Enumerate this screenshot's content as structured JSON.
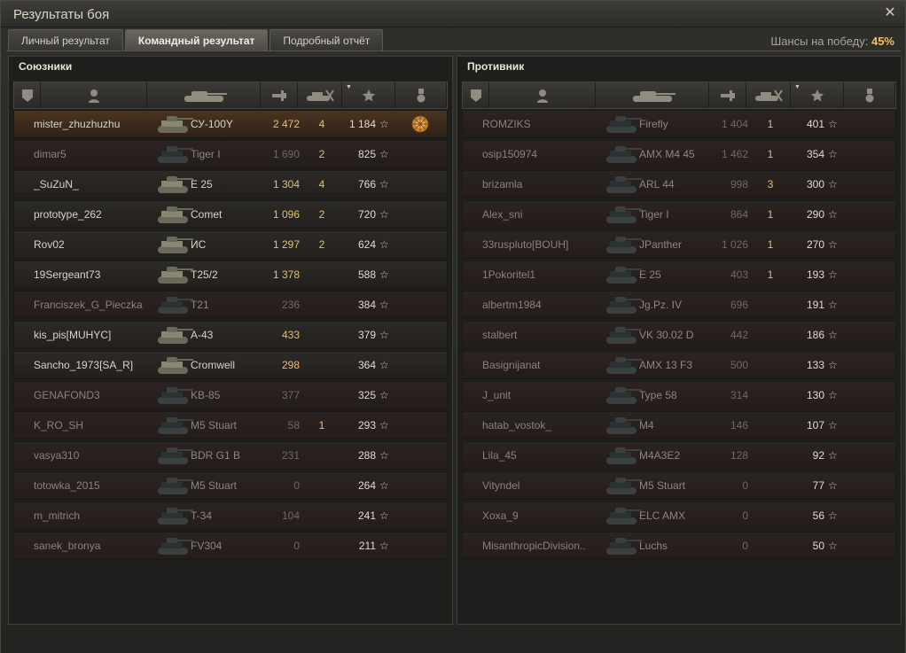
{
  "window": {
    "title": "Результаты боя",
    "close_glyph": "✕"
  },
  "tabs": [
    {
      "label": "Личный результат",
      "active": false
    },
    {
      "label": "Командный результат",
      "active": true
    },
    {
      "label": "Подробный отчёт",
      "active": false
    }
  ],
  "win_chance": {
    "label": "Шансы на победу:",
    "value": "45%"
  },
  "columns": [
    "squad-icon",
    "player-icon",
    "tank-icon",
    "damage-icon",
    "kills-icon",
    "xp-star-icon",
    "medal-icon"
  ],
  "allies": {
    "title": "Союзники",
    "rows": [
      {
        "name": "mister_zhuzhuzhu",
        "vehicle": "СУ-100Y",
        "damage": "2 472",
        "kills": "4",
        "xp": "1 184",
        "state": "me",
        "medal": true
      },
      {
        "name": "dimar5",
        "vehicle": "Tiger I",
        "damage": "1 690",
        "kills": "2",
        "xp": "825",
        "state": "dead"
      },
      {
        "name": "_SuZuN_",
        "vehicle": "E 25",
        "damage": "1 304",
        "kills": "4",
        "xp": "766",
        "state": "alive"
      },
      {
        "name": "prototype_262",
        "vehicle": "Comet",
        "damage": "1 096",
        "kills": "2",
        "xp": "720",
        "state": "alive"
      },
      {
        "name": "Rov02",
        "vehicle": "ИС",
        "damage": "1 297",
        "kills": "2",
        "xp": "624",
        "state": "alive"
      },
      {
        "name": "19Sergeant73",
        "vehicle": "T25/2",
        "damage": "1 378",
        "kills": "",
        "xp": "588",
        "state": "alive"
      },
      {
        "name": "Franciszek_G_Pieczka",
        "vehicle": "T21",
        "damage": "236",
        "kills": "",
        "xp": "384",
        "state": "dead"
      },
      {
        "name": "kis_pis[MUHYC]",
        "vehicle": "A-43",
        "damage": "433",
        "kills": "",
        "xp": "379",
        "state": "alive"
      },
      {
        "name": "Sancho_1973[SA_R]",
        "vehicle": "Cromwell",
        "damage": "298",
        "kills": "",
        "xp": "364",
        "state": "alive"
      },
      {
        "name": "GENAFOND3",
        "vehicle": "KB-85",
        "damage": "377",
        "kills": "",
        "xp": "325",
        "state": "dead"
      },
      {
        "name": "K_RO_SH",
        "vehicle": "M5 Stuart",
        "damage": "58",
        "kills": "1",
        "xp": "293",
        "state": "dead"
      },
      {
        "name": "vasya310",
        "vehicle": "BDR G1 B",
        "damage": "231",
        "kills": "",
        "xp": "288",
        "state": "dead"
      },
      {
        "name": "totowka_2015",
        "vehicle": "M5 Stuart",
        "damage": "0",
        "kills": "",
        "xp": "264",
        "state": "dead"
      },
      {
        "name": "m_mitrich",
        "vehicle": "T-34",
        "damage": "104",
        "kills": "",
        "xp": "241",
        "state": "dead"
      },
      {
        "name": "sanek_bronya",
        "vehicle": "FV304",
        "damage": "0",
        "kills": "",
        "xp": "211",
        "state": "dead"
      }
    ]
  },
  "enemies": {
    "title": "Противник",
    "rows": [
      {
        "name": "ROMZIKS",
        "vehicle": "Firefly",
        "damage": "1 404",
        "kills": "1",
        "xp": "401",
        "state": "enemy"
      },
      {
        "name": "osip150974",
        "vehicle": "AMX M4 45",
        "damage": "1 462",
        "kills": "1",
        "xp": "354",
        "state": "enemy"
      },
      {
        "name": "brizamla",
        "vehicle": "ARL 44",
        "damage": "998",
        "kills": "3",
        "xp": "300",
        "state": "enemy"
      },
      {
        "name": "Alex_sni",
        "vehicle": "Tiger I",
        "damage": "864",
        "kills": "1",
        "xp": "290",
        "state": "enemy"
      },
      {
        "name": "33ruspluto[BOUH]",
        "vehicle": "JPanther",
        "damage": "1 026",
        "kills": "1",
        "xp": "270",
        "state": "enemy"
      },
      {
        "name": "1Pokoritel1",
        "vehicle": "E 25",
        "damage": "403",
        "kills": "1",
        "xp": "193",
        "state": "enemy"
      },
      {
        "name": "albertm1984",
        "vehicle": "Jg.Pz. IV",
        "damage": "696",
        "kills": "",
        "xp": "191",
        "state": "enemy"
      },
      {
        "name": "stalbert",
        "vehicle": "VK 30.02 D",
        "damage": "442",
        "kills": "",
        "xp": "186",
        "state": "enemy"
      },
      {
        "name": "Basignijanat",
        "vehicle": "AMX 13 F3",
        "damage": "500",
        "kills": "",
        "xp": "133",
        "state": "enemy"
      },
      {
        "name": "J_unit",
        "vehicle": "Type 58",
        "damage": "314",
        "kills": "",
        "xp": "130",
        "state": "enemy"
      },
      {
        "name": "hatab_vostok_",
        "vehicle": "M4",
        "damage": "146",
        "kills": "",
        "xp": "107",
        "state": "enemy"
      },
      {
        "name": "Lila_45",
        "vehicle": "M4A3E2",
        "damage": "128",
        "kills": "",
        "xp": "92",
        "state": "enemy"
      },
      {
        "name": "Vityndel",
        "vehicle": "M5 Stuart",
        "damage": "0",
        "kills": "",
        "xp": "77",
        "state": "enemy"
      },
      {
        "name": "Xoxa_9",
        "vehicle": "ELC AMX",
        "damage": "0",
        "kills": "",
        "xp": "56",
        "state": "enemy"
      },
      {
        "name": "MisanthropicDivision..",
        "vehicle": "Luchs",
        "damage": "0",
        "kills": "",
        "xp": "50",
        "state": "enemy"
      }
    ]
  },
  "colors": {
    "accent": "#f0c060",
    "damage": "#e4c070",
    "me_row": "#4a3320"
  }
}
